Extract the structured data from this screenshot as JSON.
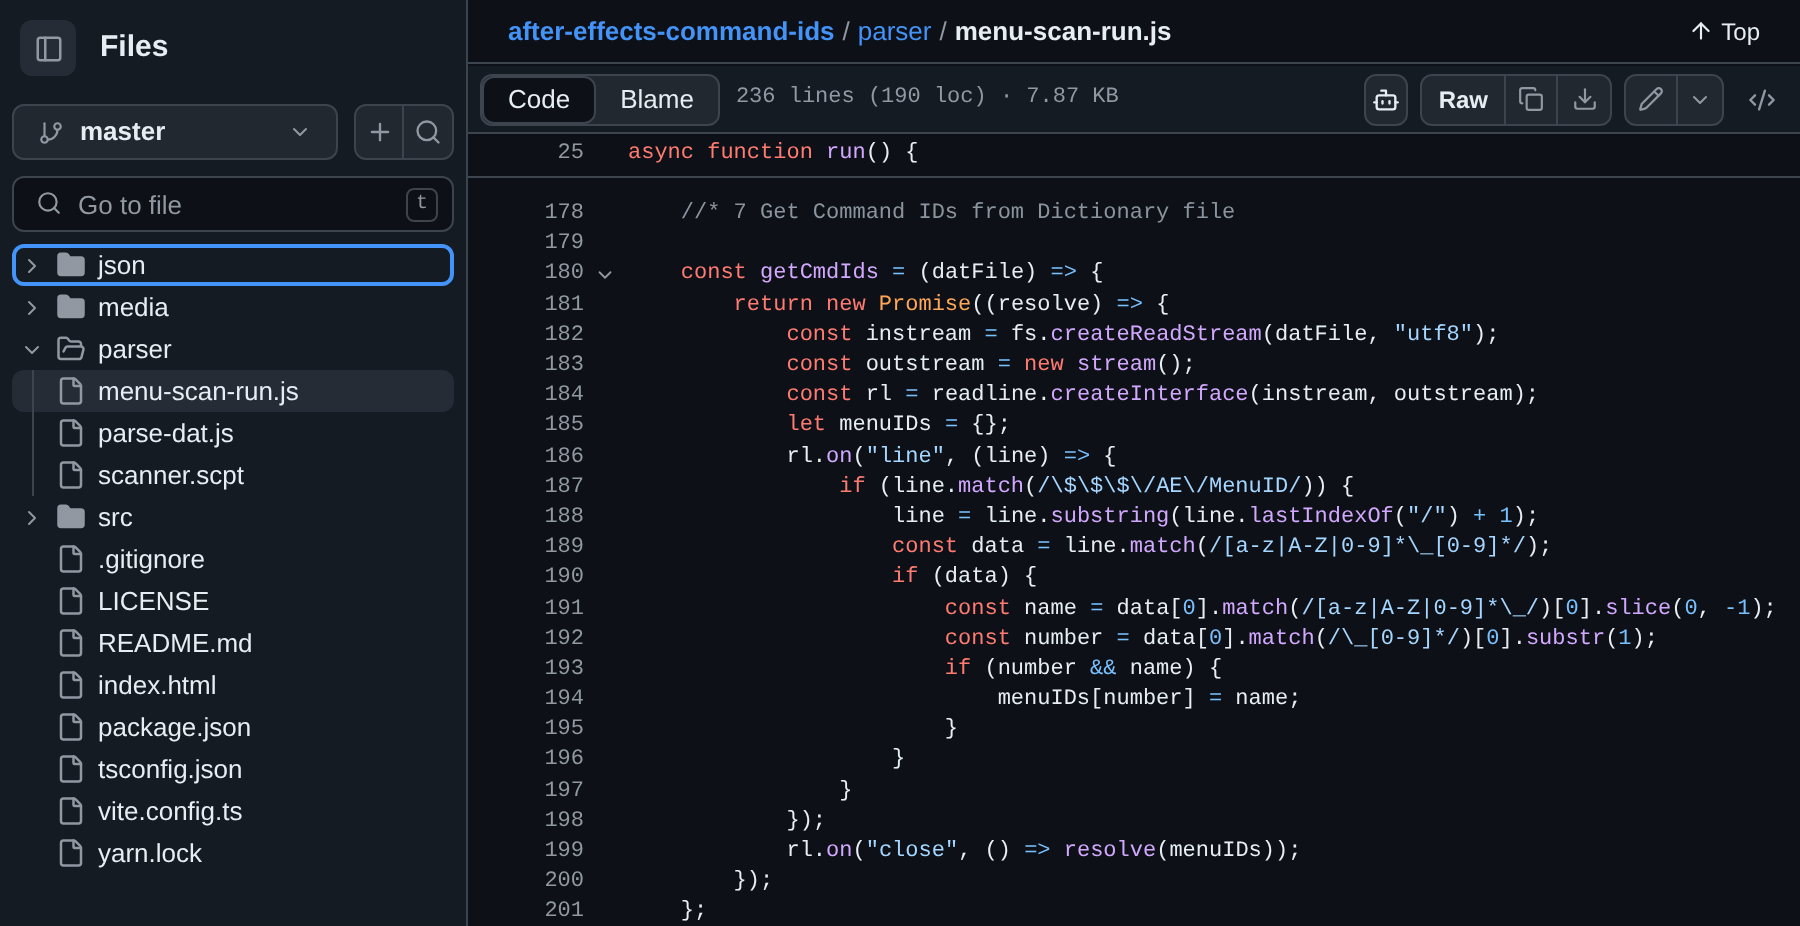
{
  "sidebar": {
    "title": "Files",
    "branch": "master",
    "search": {
      "placeholder": "Go to file",
      "shortcut": "t"
    },
    "tree": [
      {
        "name": "json",
        "kind": "folder",
        "expanded": false,
        "selected": false,
        "focused": true
      },
      {
        "name": "media",
        "kind": "folder",
        "expanded": false,
        "selected": false,
        "focused": false
      },
      {
        "name": "parser",
        "kind": "folder",
        "expanded": true,
        "selected": false,
        "focused": false,
        "children": [
          {
            "name": "menu-scan-run.js",
            "kind": "file",
            "selected": true,
            "focused": false
          },
          {
            "name": "parse-dat.js",
            "kind": "file",
            "selected": false,
            "focused": false
          },
          {
            "name": "scanner.scpt",
            "kind": "file",
            "selected": false,
            "focused": false
          }
        ]
      },
      {
        "name": "src",
        "kind": "folder",
        "expanded": false,
        "selected": false,
        "focused": false
      },
      {
        "name": ".gitignore",
        "kind": "file",
        "selected": false,
        "focused": false
      },
      {
        "name": "LICENSE",
        "kind": "file",
        "selected": false,
        "focused": false
      },
      {
        "name": "README.md",
        "kind": "file",
        "selected": false,
        "focused": false
      },
      {
        "name": "index.html",
        "kind": "file",
        "selected": false,
        "focused": false
      },
      {
        "name": "package.json",
        "kind": "file",
        "selected": false,
        "focused": false
      },
      {
        "name": "tsconfig.json",
        "kind": "file",
        "selected": false,
        "focused": false
      },
      {
        "name": "vite.config.ts",
        "kind": "file",
        "selected": false,
        "focused": false
      },
      {
        "name": "yarn.lock",
        "kind": "file",
        "selected": false,
        "focused": false
      }
    ]
  },
  "breadcrumb": {
    "repo": "after-effects-command-ids",
    "separator1": "/",
    "folder": "parser",
    "separator2": "/",
    "file": "menu-scan-run.js"
  },
  "top_link": "Top",
  "tabs": [
    {
      "label": "Code",
      "selected": true
    },
    {
      "label": "Blame",
      "selected": false
    }
  ],
  "file_info": "236 lines (190 loc) · 7.87 KB",
  "raw_button": "Raw",
  "sticky_line": {
    "n": "25",
    "tokens": [
      {
        "kind": "kw",
        "text": "async function "
      },
      {
        "kind": "fn",
        "text": "run"
      },
      {
        "kind": "pl",
        "text": "() {"
      }
    ]
  },
  "lines": [
    {
      "n": "178",
      "fold": false,
      "tokens": [
        {
          "kind": "cm",
          "text": "    //* 7 Get Command IDs from Dictionary file"
        }
      ]
    },
    {
      "n": "179",
      "fold": false
    },
    {
      "n": "180",
      "fold": true,
      "tokens": [
        {
          "kind": "kw",
          "text": "    const "
        },
        {
          "kind": "fn",
          "text": "getCmdIds"
        },
        {
          "kind": "op",
          "text": " = "
        },
        {
          "kind": "pl",
          "text": "(datFile) "
        },
        {
          "kind": "op",
          "text": "=>"
        },
        {
          "kind": "pl",
          "text": " {"
        }
      ]
    },
    {
      "n": "181",
      "fold": false,
      "tokens": [
        {
          "kind": "kw",
          "text": "        return new "
        },
        {
          "kind": "ty",
          "text": "Promise"
        },
        {
          "kind": "pl",
          "text": "((resolve) "
        },
        {
          "kind": "op",
          "text": "=>"
        },
        {
          "kind": "pl",
          "text": " {"
        }
      ]
    },
    {
      "n": "182",
      "fold": false,
      "tokens": [
        {
          "kind": "kw",
          "text": "            const "
        },
        {
          "kind": "pl",
          "text": "instream "
        },
        {
          "kind": "op",
          "text": "="
        },
        {
          "kind": "pl",
          "text": " fs."
        },
        {
          "kind": "fn",
          "text": "createReadStream"
        },
        {
          "kind": "pl",
          "text": "(datFile, "
        },
        {
          "kind": "st",
          "text": "\"utf8\""
        },
        {
          "kind": "pl",
          "text": ");"
        }
      ]
    },
    {
      "n": "183",
      "fold": false,
      "tokens": [
        {
          "kind": "kw",
          "text": "            const "
        },
        {
          "kind": "pl",
          "text": "outstream "
        },
        {
          "kind": "op",
          "text": "="
        },
        {
          "kind": "kw",
          "text": " new "
        },
        {
          "kind": "fn",
          "text": "stream"
        },
        {
          "kind": "pl",
          "text": "();"
        }
      ]
    },
    {
      "n": "184",
      "fold": false,
      "tokens": [
        {
          "kind": "kw",
          "text": "            const "
        },
        {
          "kind": "pl",
          "text": "rl "
        },
        {
          "kind": "op",
          "text": "="
        },
        {
          "kind": "pl",
          "text": " readline."
        },
        {
          "kind": "fn",
          "text": "createInterface"
        },
        {
          "kind": "pl",
          "text": "(instream, outstream);"
        }
      ]
    },
    {
      "n": "185",
      "fold": false,
      "tokens": [
        {
          "kind": "kw",
          "text": "            let "
        },
        {
          "kind": "pl",
          "text": "menuIDs "
        },
        {
          "kind": "op",
          "text": "="
        },
        {
          "kind": "pl",
          "text": " {};"
        }
      ]
    },
    {
      "n": "186",
      "fold": false,
      "tokens": [
        {
          "kind": "pl",
          "text": "            rl."
        },
        {
          "kind": "fn",
          "text": "on"
        },
        {
          "kind": "pl",
          "text": "("
        },
        {
          "kind": "st",
          "text": "\"line\""
        },
        {
          "kind": "pl",
          "text": ", (line) "
        },
        {
          "kind": "op",
          "text": "=>"
        },
        {
          "kind": "pl",
          "text": " {"
        }
      ]
    },
    {
      "n": "187",
      "fold": false,
      "tokens": [
        {
          "kind": "kw",
          "text": "                if "
        },
        {
          "kind": "pl",
          "text": "(line."
        },
        {
          "kind": "fn",
          "text": "match"
        },
        {
          "kind": "pl",
          "text": "("
        },
        {
          "kind": "st",
          "text": "/\\$\\$\\$\\/AE\\/MenuID/"
        },
        {
          "kind": "pl",
          "text": ")) {"
        }
      ]
    },
    {
      "n": "188",
      "fold": false,
      "tokens": [
        {
          "kind": "pl",
          "text": "                    line "
        },
        {
          "kind": "op",
          "text": "="
        },
        {
          "kind": "pl",
          "text": " line."
        },
        {
          "kind": "fn",
          "text": "substring"
        },
        {
          "kind": "pl",
          "text": "(line."
        },
        {
          "kind": "fn",
          "text": "lastIndexOf"
        },
        {
          "kind": "pl",
          "text": "("
        },
        {
          "kind": "st",
          "text": "\"/\""
        },
        {
          "kind": "pl",
          "text": ") "
        },
        {
          "kind": "op",
          "text": "+"
        },
        {
          "kind": "op",
          "text": " 1"
        },
        {
          "kind": "pl",
          "text": ");"
        }
      ]
    },
    {
      "n": "189",
      "fold": false,
      "tokens": [
        {
          "kind": "kw",
          "text": "                    const "
        },
        {
          "kind": "pl",
          "text": "data "
        },
        {
          "kind": "op",
          "text": "="
        },
        {
          "kind": "pl",
          "text": " line."
        },
        {
          "kind": "fn",
          "text": "match"
        },
        {
          "kind": "pl",
          "text": "("
        },
        {
          "kind": "st",
          "text": "/[a-z|A-Z|0-9]*\\_[0-9]*/"
        },
        {
          "kind": "pl",
          "text": ");"
        }
      ]
    },
    {
      "n": "190",
      "fold": false,
      "tokens": [
        {
          "kind": "kw",
          "text": "                    if "
        },
        {
          "kind": "pl",
          "text": "(data) {"
        }
      ]
    },
    {
      "n": "191",
      "fold": false,
      "tokens": [
        {
          "kind": "kw",
          "text": "                        const "
        },
        {
          "kind": "pl",
          "text": "name "
        },
        {
          "kind": "op",
          "text": "="
        },
        {
          "kind": "pl",
          "text": " data["
        },
        {
          "kind": "op",
          "text": "0"
        },
        {
          "kind": "pl",
          "text": "]."
        },
        {
          "kind": "fn",
          "text": "match"
        },
        {
          "kind": "pl",
          "text": "("
        },
        {
          "kind": "st",
          "text": "/[a-z|A-Z|0-9]*\\_/"
        },
        {
          "kind": "pl",
          "text": ")["
        },
        {
          "kind": "op",
          "text": "0"
        },
        {
          "kind": "pl",
          "text": "]."
        },
        {
          "kind": "fn",
          "text": "slice"
        },
        {
          "kind": "pl",
          "text": "("
        },
        {
          "kind": "op",
          "text": "0"
        },
        {
          "kind": "pl",
          "text": ", "
        },
        {
          "kind": "op",
          "text": "-1"
        },
        {
          "kind": "pl",
          "text": ");"
        }
      ]
    },
    {
      "n": "192",
      "fold": false,
      "tokens": [
        {
          "kind": "kw",
          "text": "                        const "
        },
        {
          "kind": "pl",
          "text": "number "
        },
        {
          "kind": "op",
          "text": "="
        },
        {
          "kind": "pl",
          "text": " data["
        },
        {
          "kind": "op",
          "text": "0"
        },
        {
          "kind": "pl",
          "text": "]."
        },
        {
          "kind": "fn",
          "text": "match"
        },
        {
          "kind": "pl",
          "text": "("
        },
        {
          "kind": "st",
          "text": "/\\_[0-9]*/"
        },
        {
          "kind": "pl",
          "text": ")["
        },
        {
          "kind": "op",
          "text": "0"
        },
        {
          "kind": "pl",
          "text": "]."
        },
        {
          "kind": "fn",
          "text": "substr"
        },
        {
          "kind": "pl",
          "text": "("
        },
        {
          "kind": "op",
          "text": "1"
        },
        {
          "kind": "pl",
          "text": ");"
        }
      ]
    },
    {
      "n": "193",
      "fold": false,
      "tokens": [
        {
          "kind": "kw",
          "text": "                        if "
        },
        {
          "kind": "pl",
          "text": "(number "
        },
        {
          "kind": "op",
          "text": "&&"
        },
        {
          "kind": "pl",
          "text": " name) {"
        }
      ]
    },
    {
      "n": "194",
      "fold": false,
      "tokens": [
        {
          "kind": "pl",
          "text": "                            menuIDs[number] "
        },
        {
          "kind": "op",
          "text": "="
        },
        {
          "kind": "pl",
          "text": " name;"
        }
      ]
    },
    {
      "n": "195",
      "fold": false,
      "tokens": [
        {
          "kind": "pl",
          "text": "                        }"
        }
      ]
    },
    {
      "n": "196",
      "fold": false,
      "tokens": [
        {
          "kind": "pl",
          "text": "                    }"
        }
      ]
    },
    {
      "n": "197",
      "fold": false,
      "tokens": [
        {
          "kind": "pl",
          "text": "                }"
        }
      ]
    },
    {
      "n": "198",
      "fold": false,
      "tokens": [
        {
          "kind": "pl",
          "text": "            });"
        }
      ]
    },
    {
      "n": "199",
      "fold": false,
      "tokens": [
        {
          "kind": "pl",
          "text": "            rl."
        },
        {
          "kind": "fn",
          "text": "on"
        },
        {
          "kind": "pl",
          "text": "("
        },
        {
          "kind": "st",
          "text": "\"close\""
        },
        {
          "kind": "pl",
          "text": ", () "
        },
        {
          "kind": "op",
          "text": "=>"
        },
        {
          "kind": "fn",
          "text": " resolve"
        },
        {
          "kind": "pl",
          "text": "(menuIDs));"
        }
      ]
    },
    {
      "n": "200",
      "fold": false,
      "tokens": [
        {
          "kind": "pl",
          "text": "        });"
        }
      ]
    },
    {
      "n": "201",
      "fold": false,
      "tokens": [
        {
          "kind": "pl",
          "text": "    };"
        }
      ]
    }
  ]
}
